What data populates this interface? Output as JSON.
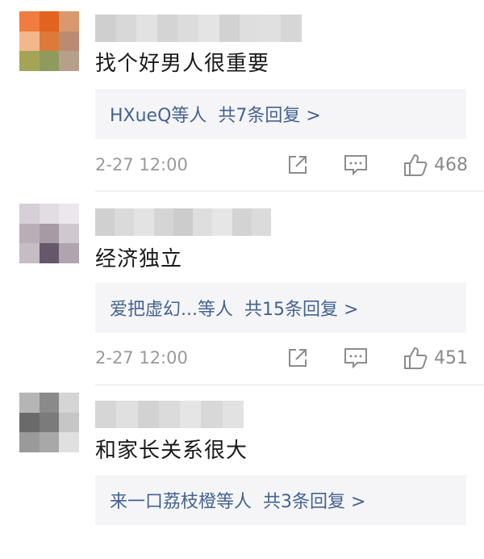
{
  "comments": [
    {
      "avatar_colors": [
        "#f07c40",
        "#e1631f",
        "#d9986e",
        "#f2b78a",
        "#dd7a3b",
        "#ba8a73",
        "#a3a456",
        "#8f9b5d",
        "#b6a08c"
      ],
      "name_colors": [
        "#cfcfcf",
        "#d8d8d8",
        "#e2e2e2",
        "#d4d4d4",
        "#dcdcdc",
        "#e4e4e4",
        "#d2d2d2",
        "#dedede",
        "#e0e0e0",
        "#d6d6d6"
      ],
      "text": "找个好男人很重要",
      "reply_who": "HXueQ等人",
      "reply_count": "共7条回复 >",
      "time": "2-27 12:00",
      "likes": "468"
    },
    {
      "avatar_colors": [
        "#d4d0d6",
        "#e2dde3",
        "#ebe7ec",
        "#b9adb6",
        "#a69aa5",
        "#cfc8cf",
        "#c5bcc4",
        "#66586a",
        "#b0a5af"
      ],
      "name_colors": [
        "#d0d0d0",
        "#dadada",
        "#e3e3e3",
        "#d5d5d5",
        "#cccccc",
        "#dedede",
        "#e6e6e6",
        "#d3d3d3",
        "#dbdbdb"
      ],
      "text": "经济独立",
      "reply_who": "爱把虚幻...等人",
      "reply_count": "共15条回复 >",
      "time": "2-27 12:00",
      "likes": "451"
    },
    {
      "avatar_colors": [
        "#b5b5b5",
        "#8a8a8a",
        "#d5d5d5",
        "#6a6a6a",
        "#7b7b7b",
        "#c6c6c6",
        "#9a9a9a",
        "#a8a8a8",
        "#e0e0e0"
      ],
      "name_colors": [
        "#d6d6d6",
        "#e0e0e0",
        "#d2d2d2",
        "#dbdbdb",
        "#e5e5e5",
        "#d8d8d8",
        "#e2e2e2"
      ],
      "text": "和家长关系很大",
      "reply_who": "来一口荔枝橙等人",
      "reply_count": "共3条回复 >",
      "time": "",
      "likes": ""
    }
  ],
  "icons": [
    "share-icon",
    "comment-icon",
    "like-icon"
  ],
  "accent_color": "#436390"
}
